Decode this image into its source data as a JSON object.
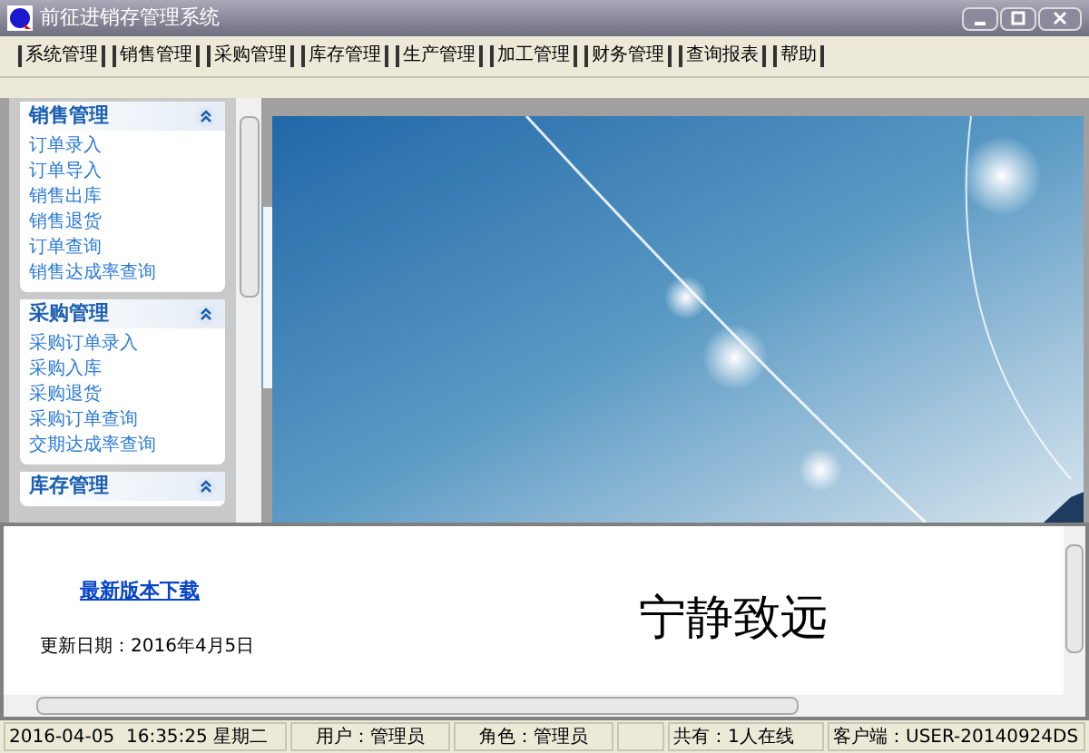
{
  "window": {
    "title": "前征进销存管理系统"
  },
  "menu": [
    "系统管理",
    "销售管理",
    "采购管理",
    "库存管理",
    "生产管理",
    "加工管理",
    "财务管理",
    "查询报表",
    "帮助"
  ],
  "sidebar": {
    "groups": [
      {
        "title": "销售管理",
        "expanded": true,
        "items": [
          "订单录入",
          "订单导入",
          "销售出库",
          "销售退货",
          "订单查询",
          "销售达成率查询"
        ]
      },
      {
        "title": "采购管理",
        "expanded": true,
        "items": [
          "采购订单录入",
          "采购入库",
          "采购退货",
          "采购订单查询",
          "交期达成率查询"
        ]
      },
      {
        "title": "库存管理",
        "expanded": true
      }
    ]
  },
  "info": {
    "link": "最新版本下载",
    "update_date": "更新日期：2016年4月5日",
    "motto": "宁静致远"
  },
  "status_bar": [
    "2016-04-05  16:35:25 星期二",
    "用户：管理员",
    "角色：管理员",
    "共有：1人在线",
    "客户端：USER-20140924DS"
  ]
}
